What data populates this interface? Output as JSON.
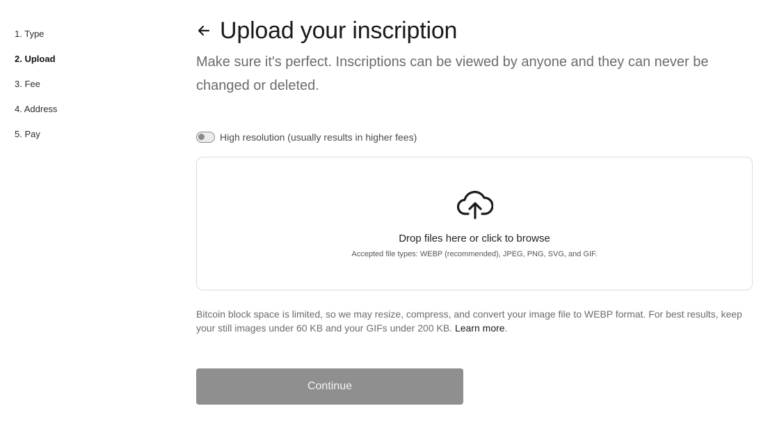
{
  "sidebar": {
    "steps": [
      {
        "label": "1. Type"
      },
      {
        "label": "2. Upload"
      },
      {
        "label": "3. Fee"
      },
      {
        "label": "4. Address"
      },
      {
        "label": "5. Pay"
      }
    ],
    "active_step": "2. Upload"
  },
  "header": {
    "back_icon": "arrow-left-icon",
    "title": "Upload your inscription",
    "subtitle": "Make sure it's perfect. Inscriptions can be viewed by anyone and they can never be changed or deleted."
  },
  "high_resolution": {
    "label": "High resolution (usually results in higher fees)",
    "enabled": false
  },
  "dropzone": {
    "icon": "cloud-upload-icon",
    "title": "Drop files here or click to browse",
    "accepted_types": "Accepted file types: WEBP (recommended), JPEG, PNG, SVG, and GIF."
  },
  "note": {
    "text": "Bitcoin block space is limited, so we may resize, compress, and convert your image file to WEBP format. For best results, keep your still images under 60 KB and your GIFs under 200 KB.",
    "link": "Learn more"
  },
  "actions": {
    "continue_label": "Continue"
  },
  "colors": {
    "continue_bg": "#8f8f8f",
    "subtitle": "#6b6b6b"
  }
}
